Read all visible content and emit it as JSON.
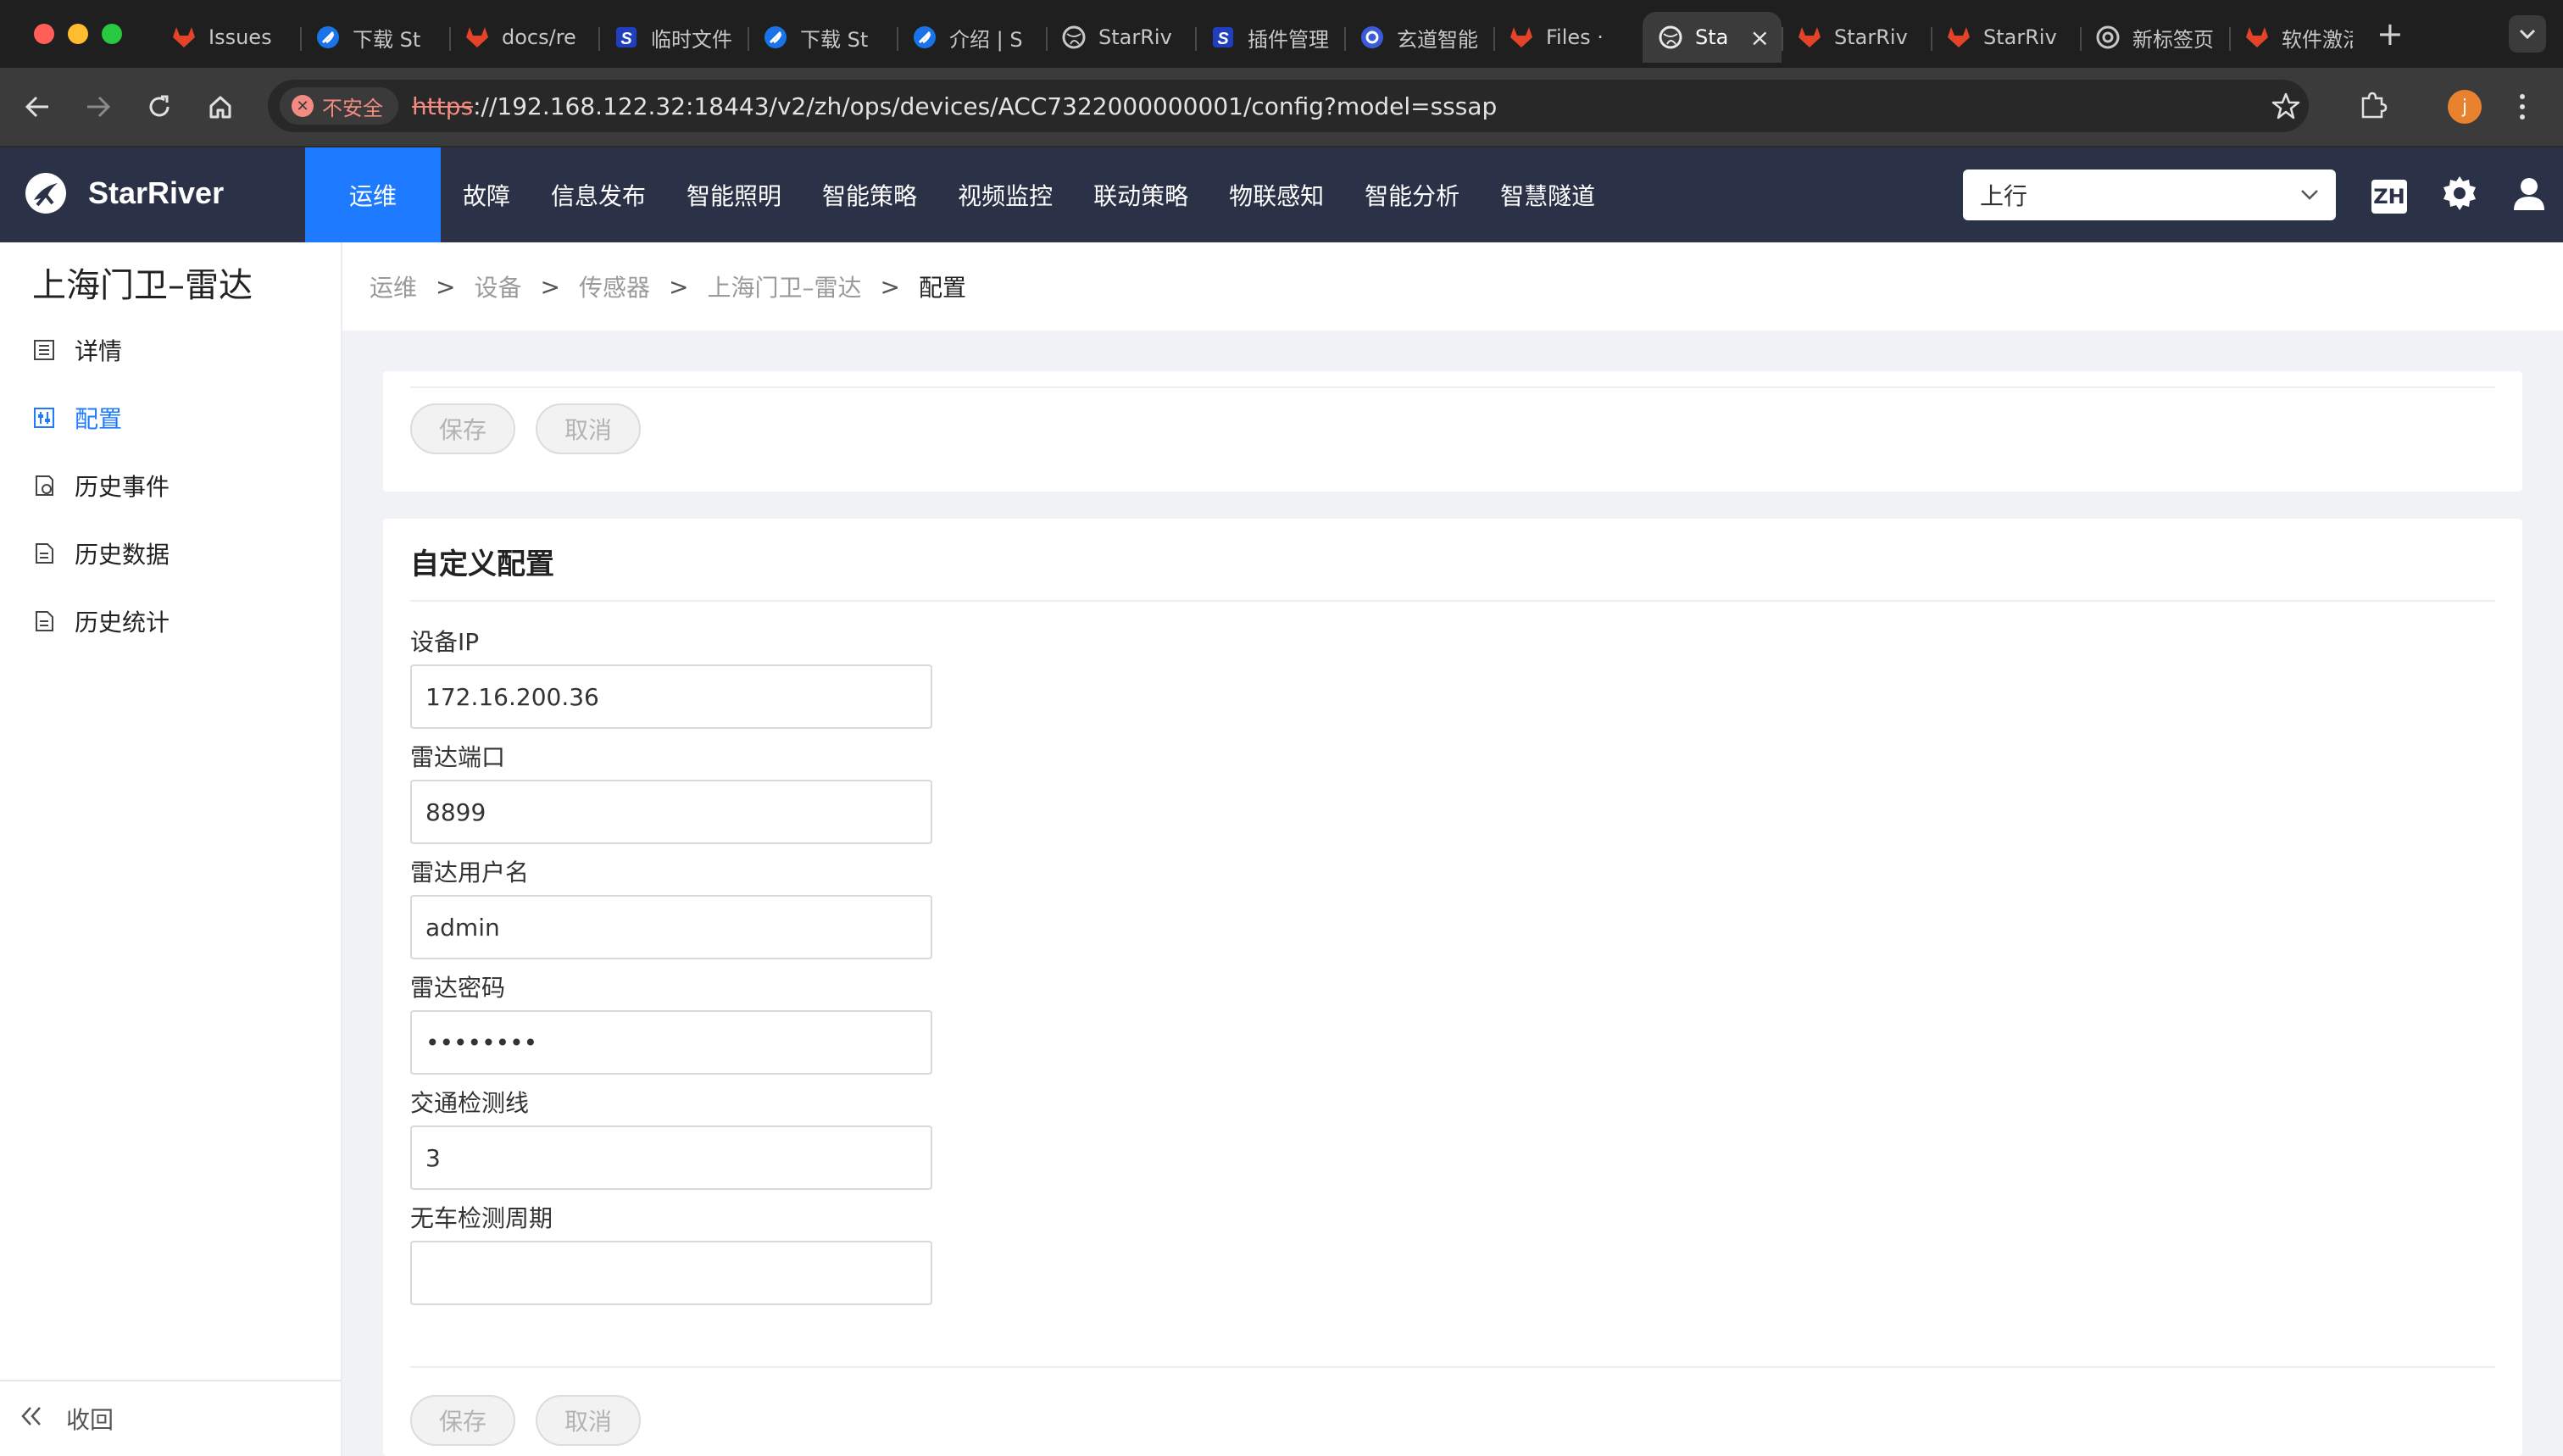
{
  "browser": {
    "tabs": [
      {
        "label": "Issues",
        "icon": "gitlab-icon"
      },
      {
        "label": "下载 St",
        "icon": "blue-feather-icon"
      },
      {
        "label": "docs/re",
        "icon": "gitlab-icon"
      },
      {
        "label": "临时文件",
        "icon": "s-logo-icon"
      },
      {
        "label": "下载 St",
        "icon": "blue-feather-icon"
      },
      {
        "label": "介绍 | S",
        "icon": "blue-feather-icon"
      },
      {
        "label": "StarRiv",
        "icon": "globe-icon"
      },
      {
        "label": "插件管理",
        "icon": "s-logo-icon"
      },
      {
        "label": "玄道智能",
        "icon": "blue-circle-icon"
      },
      {
        "label": "Files ·",
        "icon": "gitlab-icon"
      },
      {
        "label": "Sta",
        "icon": "globe-icon",
        "active": true
      },
      {
        "label": "StarRiv",
        "icon": "gitlab-icon"
      },
      {
        "label": "StarRiv",
        "icon": "gitlab-icon"
      },
      {
        "label": "新标签页",
        "icon": "chrome-icon"
      },
      {
        "label": "软件激活",
        "icon": "gitlab-icon"
      }
    ],
    "security_chip": "不安全",
    "url_scheme": "https",
    "url_rest": "://192.168.122.32:18443/v2/zh/ops/devices/ACC7322000000001/config?model=sssap",
    "profile_initial": "j"
  },
  "app": {
    "brand": "StarRiver",
    "nav": [
      "运维",
      "故障",
      "信息发布",
      "智能照明",
      "智能策略",
      "视频监控",
      "联动策略",
      "物联感知",
      "智能分析",
      "智慧隧道"
    ],
    "direction": "上行",
    "lang": "ZH"
  },
  "sidebar": {
    "title": "上海门卫–雷达",
    "items": [
      {
        "label": "详情",
        "icon": "list-doc-icon"
      },
      {
        "label": "配置",
        "icon": "sliders-icon"
      },
      {
        "label": "历史事件",
        "icon": "event-doc-icon"
      },
      {
        "label": "历史数据",
        "icon": "doc-icon"
      },
      {
        "label": "历史统计",
        "icon": "doc-icon"
      }
    ],
    "collapse": "收回"
  },
  "breadcrumb": [
    "运维",
    "设备",
    "传感器",
    "上海门卫–雷达",
    "配置"
  ],
  "buttons": {
    "save": "保存",
    "cancel": "取消"
  },
  "config": {
    "section_title": "自定义配置",
    "fields": [
      {
        "label": "设备IP",
        "value": "172.16.200.36"
      },
      {
        "label": "雷达端口",
        "value": "8899"
      },
      {
        "label": "雷达用户名",
        "value": "admin"
      },
      {
        "label": "雷达密码",
        "value": "••••••••"
      },
      {
        "label": "交通检测线",
        "value": "3"
      },
      {
        "label": "无车检测周期",
        "value": ""
      }
    ]
  },
  "colors": {
    "accent": "#1e7bff",
    "header_bg": "#2b3247",
    "content_bg": "#f0f2f5"
  }
}
